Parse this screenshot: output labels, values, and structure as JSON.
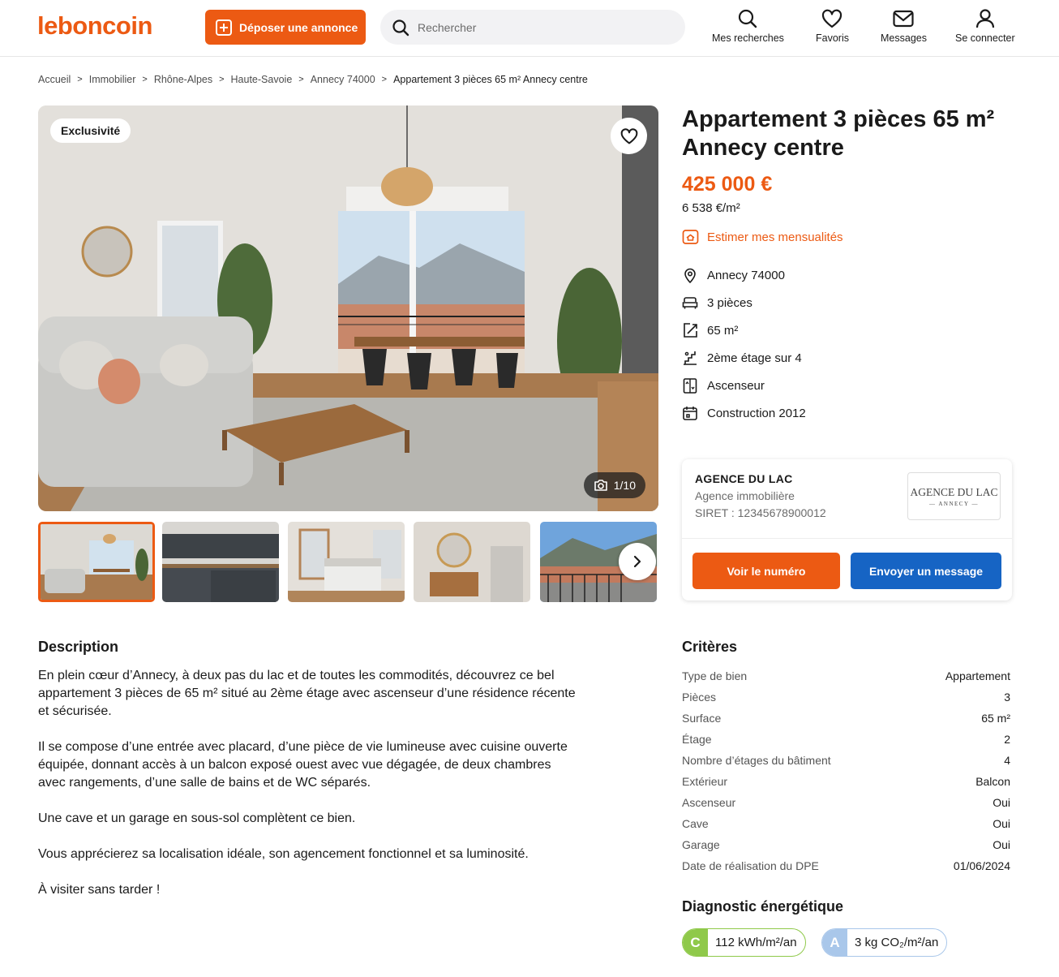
{
  "header": {
    "logo": "leboncoin",
    "post_button": "Déposer une annonce",
    "search_placeholder": "Rechercher",
    "nav": {
      "searches": "Mes recherches",
      "favorites": "Favoris",
      "messages": "Messages",
      "login": "Se connecter"
    }
  },
  "breadcrumb": [
    "Accueil",
    "Immobilier",
    "Rhône-Alpes",
    "Haute-Savoie",
    "Annecy 74000",
    "Appartement 3 pièces 65 m² Annecy centre"
  ],
  "gallery": {
    "badge": "Exclusivité",
    "counter": "1/10",
    "active_thumb": 0
  },
  "listing": {
    "title": "Appartement 3 pièces 65 m² Annecy centre",
    "price": "425 000 €",
    "price_per_m2": "6 538 €/m²",
    "estimate_link": "Estimer mes mensualités",
    "features": [
      {
        "icon": "location-pin-icon",
        "label": "Annecy 74000"
      },
      {
        "icon": "sofa-icon",
        "label": "3 pièces"
      },
      {
        "icon": "surface-icon",
        "label": "65 m²"
      },
      {
        "icon": "stairs-icon",
        "label": "2ème étage sur 4"
      },
      {
        "icon": "elevator-icon",
        "label": "Ascenseur"
      },
      {
        "icon": "calendar-icon",
        "label": "Construction 2012"
      }
    ]
  },
  "agency": {
    "name": "AGENCE DU LAC",
    "type": "Agence immobilière",
    "siret": "SIRET : 12345678900012",
    "logo_text": "AGENCE DU LAC",
    "logo_sub": "— ANNECY —",
    "call_button": "Voir le numéro",
    "message_button": "Envoyer un message"
  },
  "description": {
    "heading": "Description",
    "paragraphs": [
      "En plein cœur d’Annecy, à deux pas du lac et de toutes les commodités, découvrez ce bel appartement 3 pièces de 65 m² situé au 2ème étage avec ascenseur d’une résidence récente et sécurisée.",
      "Il se compose d’une entrée avec placard, d’une pièce de vie lumineuse avec cuisine ouverte équipée, donnant accès à un balcon exposé ouest avec vue dégagée, de deux chambres avec rangements, d’une salle de bains et de WC séparés.",
      "Une cave et un garage en sous-sol complètent ce bien.",
      "Vous apprécierez sa localisation idéale, son agencement fonctionnel et sa luminosité.",
      "À visiter sans tarder !"
    ]
  },
  "criteria": {
    "heading": "Critères",
    "rows": [
      {
        "k": "Type de bien",
        "v": "Appartement"
      },
      {
        "k": "Pièces",
        "v": "3"
      },
      {
        "k": "Surface",
        "v": "65 m²"
      },
      {
        "k": "Étage",
        "v": "2"
      },
      {
        "k": "Nombre d’étages du bâtiment",
        "v": "4"
      },
      {
        "k": "Extérieur",
        "v": "Balcon"
      },
      {
        "k": "Ascenseur",
        "v": "Oui"
      },
      {
        "k": "Cave",
        "v": "Oui"
      },
      {
        "k": "Garage",
        "v": "Oui"
      },
      {
        "k": "Date de réalisation du DPE",
        "v": "01/06/2024"
      }
    ]
  },
  "energy": {
    "heading": "Diagnostic énergétique",
    "dpe": {
      "letter": "C",
      "value": "112 kWh/m²/an",
      "color": "#8fc94a"
    },
    "ges": {
      "letter": "A",
      "value": "3 kg CO₂/m²/an",
      "color": "#a9c7ea"
    }
  },
  "colors": {
    "brand": "#ec5a13",
    "blue": "#1664c4"
  }
}
